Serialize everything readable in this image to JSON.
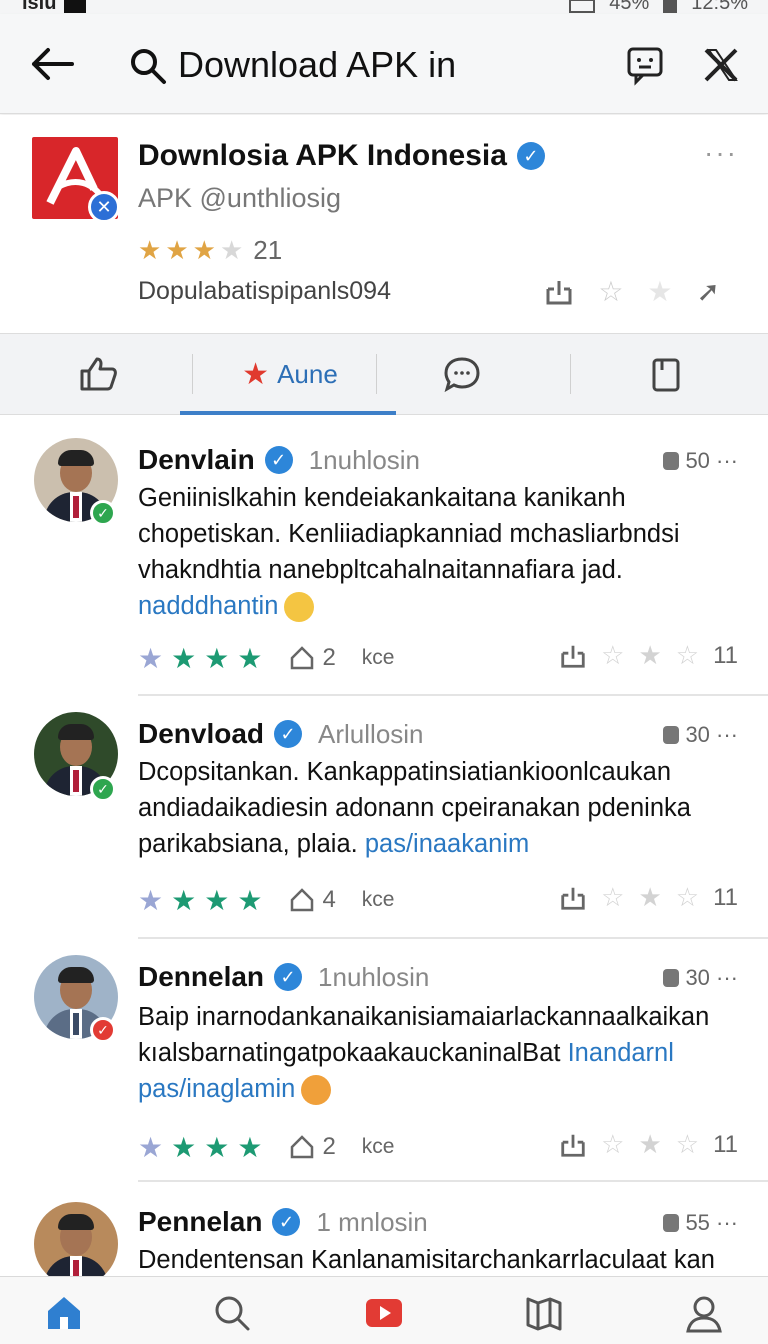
{
  "status_bar": {
    "left_text": "ısıu",
    "battery": "45%",
    "time": "12:5%"
  },
  "appbar": {
    "query": "Download APK in"
  },
  "profile": {
    "name": "Downlosia APK Indonesia",
    "handle": "APK @unthliosig",
    "rating_count": "21",
    "rating_stars": 3,
    "meta": "Dopulabatispipanls094",
    "more": "···"
  },
  "tabs": [
    {
      "name": "like",
      "label": ""
    },
    {
      "name": "aune",
      "label": "Aune"
    },
    {
      "name": "comment",
      "label": ""
    },
    {
      "name": "copy",
      "label": ""
    }
  ],
  "posts": [
    {
      "name": "Denvlain",
      "handle": "1nuhlosin",
      "stat": "50 ···",
      "badge": "green",
      "text": "Geniinislkahin kendeiakankaitana kanikanh chopetiskan. Kenliiadiapkanniad mchasliarbndsi vhakndhtia nanebpltcahalnaitannafiara jad.",
      "link": "nadddhantin",
      "shares": "2",
      "kce": "kce",
      "count": "11"
    },
    {
      "name": "Denvload",
      "handle": "Arlullosin",
      "stat": "30 ···",
      "badge": "green",
      "text": "Dcopsitankan. Kankappatinsiatiankioonlcaukan andiadaikadiesin adonann cpeiranakan pdeninka parikabsiana, plaia.",
      "link": "pas/inaakanim",
      "shares": "4",
      "kce": "kce",
      "count": "11"
    },
    {
      "name": "Dennelan",
      "handle": "1nuhlosin",
      "stat": "30 ···",
      "badge": "red",
      "text": "Baip inarnodankanaikanisiamaiarlackannaalkaikan kıalsbarnatingatpokaakauckaninalBat",
      "link": "Inandarnl pas/inaglamin",
      "shares": "2",
      "kce": "kce",
      "count": "11"
    },
    {
      "name": "Pennelan",
      "handle": "1 mnlosin",
      "stat": "55 ···",
      "badge": "red",
      "text": "Dendentensan Kanlanamisitarchankarrlaculaat kan",
      "link": "",
      "shares": "",
      "kce": "",
      "count": ""
    }
  ],
  "bottom_nav": [
    "home-icon",
    "search-icon",
    "video-icon",
    "book-icon",
    "profile-icon"
  ],
  "colors": {
    "accent": "#2d6fb6",
    "brand_red": "#d8262a",
    "star_green": "#1d9a73",
    "verified_blue": "#2d86d9"
  }
}
